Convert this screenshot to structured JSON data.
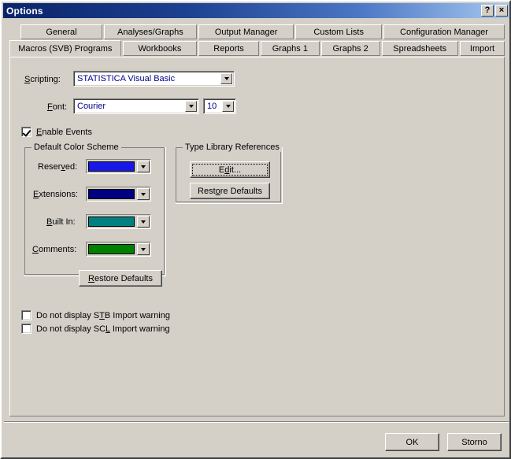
{
  "window": {
    "title": "Options",
    "help_button": "?",
    "close_button": "×"
  },
  "tabs": {
    "row_top": [
      {
        "label": "General",
        "active": false
      },
      {
        "label": "Analyses/Graphs",
        "active": false
      },
      {
        "label": "Output Manager",
        "active": false
      },
      {
        "label": "Custom Lists",
        "active": false
      },
      {
        "label": "Configuration Manager",
        "active": false
      }
    ],
    "row_bottom": [
      {
        "label": "Macros (SVB) Programs",
        "active": true
      },
      {
        "label": "Workbooks",
        "active": false
      },
      {
        "label": "Reports",
        "active": false
      },
      {
        "label": "Graphs 1",
        "active": false
      },
      {
        "label": "Graphs 2",
        "active": false
      },
      {
        "label": "Spreadsheets",
        "active": false
      },
      {
        "label": "Import",
        "active": false
      }
    ]
  },
  "form": {
    "scripting": {
      "label": "Scripting:",
      "value": "STATISTICA Visual Basic"
    },
    "font": {
      "label": "Font:",
      "value": "Courier"
    },
    "font_size": {
      "value": "10"
    },
    "enable_events": {
      "label": "Enable Events",
      "checked": true
    }
  },
  "color_scheme": {
    "title": "Default Color Scheme",
    "rows": [
      {
        "label": "Reserved:",
        "color": "#1717e8"
      },
      {
        "label": "Extensions:",
        "color": "#000080"
      },
      {
        "label": "Built In:",
        "color": "#008080"
      },
      {
        "label": "Comments:",
        "color": "#008000"
      }
    ],
    "restore_defaults_label": "Restore Defaults"
  },
  "type_library": {
    "title": "Type Library References",
    "edit_label": "Edit...",
    "restore_defaults_label": "Restore Defaults"
  },
  "options": [
    {
      "label": "Do not display STB Import warning",
      "checked": false
    },
    {
      "label": "Do not display SCL Import warning",
      "checked": false
    }
  ],
  "footer": {
    "ok_label": "OK",
    "cancel_label": "Storno"
  },
  "colors": {
    "face": "#d4d0c8",
    "title_start": "#0a246a",
    "title_end": "#a6c8ef",
    "combo_text": "#00008b"
  }
}
